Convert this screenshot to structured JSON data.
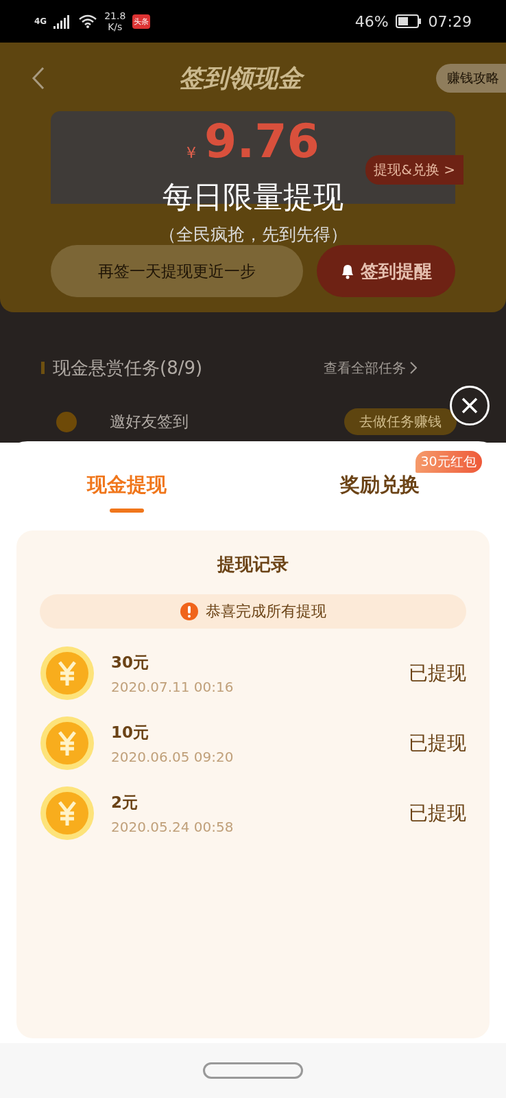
{
  "status_bar": {
    "network": "4G",
    "speed": "21.8",
    "speed_unit": "K/s",
    "app_badge": "头条",
    "battery": "46%",
    "time": "07:29"
  },
  "background_page": {
    "title": "签到领现金",
    "guide_button": "赚钱攻略",
    "balance_currency": "¥",
    "balance": "9.76",
    "withdraw_button": "提现&兑换 >",
    "hint": "再签一天提现更近一步",
    "remind_button": "签到提醒",
    "section_title": "现金悬赏任务(8/9)",
    "section_link": "查看全部任务",
    "task": "邀好友签到",
    "task_button": "去做任务赚钱"
  },
  "popup": {
    "title": "每日限量提现",
    "subtitle": "（全民疯抢，先到先得）"
  },
  "tabs": [
    {
      "label": "现金提现",
      "selected": true
    },
    {
      "label": "奖励兑换",
      "selected": false,
      "badge": "30元红包"
    }
  ],
  "records_panel": {
    "title": "提现记录",
    "notice": "恭喜完成所有提现",
    "records": [
      {
        "amount": "30元",
        "date": "2020.07.11 00:16",
        "status": "已提现"
      },
      {
        "amount": "10元",
        "date": "2020.06.05 09:20",
        "status": "已提现"
      },
      {
        "amount": "2元",
        "date": "2020.05.24 00:58",
        "status": "已提现"
      }
    ]
  }
}
